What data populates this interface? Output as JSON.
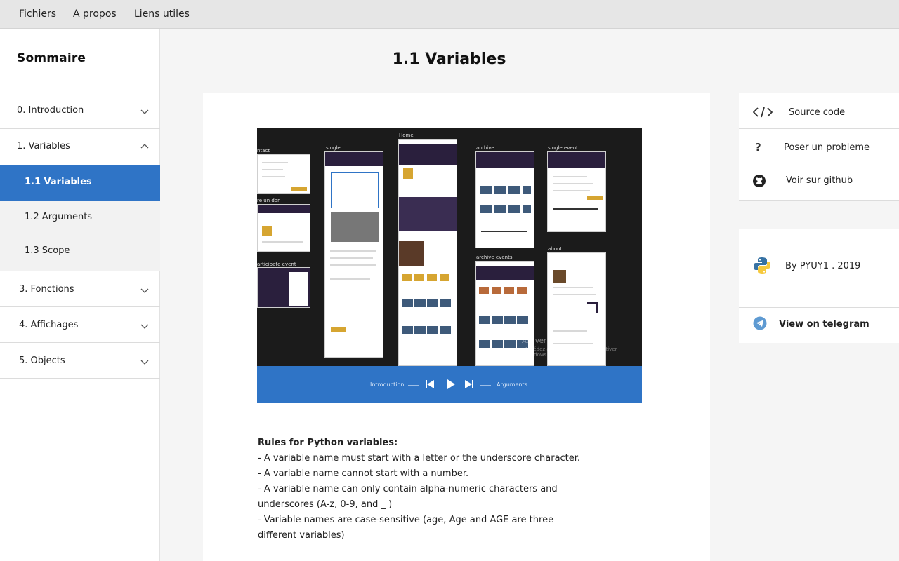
{
  "menubar": {
    "items": [
      "Fichiers",
      "A propos",
      "Liens utiles"
    ]
  },
  "sidebar": {
    "title": "Sommaire",
    "sections": [
      {
        "label": "0. Introduction",
        "expanded": false
      },
      {
        "label": "1. Variables",
        "expanded": true
      },
      {
        "label": "3. Fonctions",
        "expanded": false
      },
      {
        "label": "4. Affichages",
        "expanded": false
      },
      {
        "label": "5. Objects",
        "expanded": false
      }
    ],
    "subitems": [
      {
        "label": "1.1 Variables",
        "active": true
      },
      {
        "label": "1.2 Arguments",
        "active": false
      },
      {
        "label": "1.3 Scope",
        "active": false
      }
    ]
  },
  "main": {
    "title": "1.1 Variables",
    "video": {
      "screen_labels": [
        "ntact",
        "single",
        "Home",
        "archive",
        "single event",
        "re un don",
        "about",
        "archive events",
        "articipate event"
      ],
      "watermark_title": "Activer Windows",
      "watermark_sub": "Accédez aux paramètres pour activer Windows.",
      "player": {
        "prev_label": "Introduction",
        "next_label": "Arguments"
      }
    },
    "rules": {
      "title": "Rules for Python variables:",
      "lines": [
        "- A variable name must start with a letter or the underscore character.",
        "- A variable name cannot start with a number.",
        "- A variable name can only contain alpha-numeric characters and underscores (A-z, 0-9, and _ )",
        "- Variable names are case-sensitive (age, Age and AGE are three different variables)"
      ]
    }
  },
  "right_panel": {
    "links": [
      {
        "label": "Source code",
        "icon": "code-icon"
      },
      {
        "label": "Poser un probleme",
        "icon": "question-icon"
      },
      {
        "label": "Voir sur github",
        "icon": "github-icon"
      }
    ],
    "author": {
      "label": "By PYUY1 . 2019",
      "icon": "python-logo-icon"
    },
    "telegram": {
      "label": "View on telegram",
      "icon": "telegram-icon"
    }
  },
  "colors": {
    "accent": "#2f74c6",
    "menubar": "#e6e6e6",
    "video_bg": "#1b1b1b",
    "gold": "#d6a531",
    "header_purple": "#2a1f3d"
  }
}
